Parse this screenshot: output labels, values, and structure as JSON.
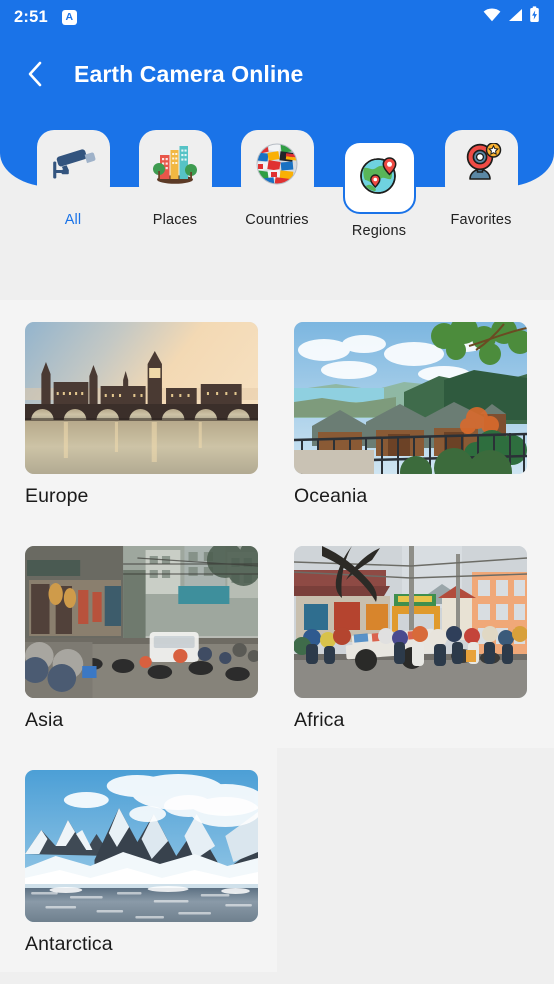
{
  "status_bar": {
    "time": "2:51",
    "notification_badge": "A",
    "icons": [
      "wifi-icon",
      "cell-signal-icon",
      "battery-charging-icon"
    ]
  },
  "app_bar": {
    "back_icon": "chevron-left-icon",
    "title": "Earth Camera Online"
  },
  "tabs": [
    {
      "label": "All",
      "icon": "cctv-camera-icon",
      "selected": false,
      "label_active": true
    },
    {
      "label": "Places",
      "icon": "cityscape-icon",
      "selected": false,
      "label_active": false
    },
    {
      "label": "Countries",
      "icon": "flags-globe-icon",
      "selected": false,
      "label_active": false
    },
    {
      "label": "Regions",
      "icon": "globe-pin-icon",
      "selected": true,
      "label_active": false
    },
    {
      "label": "Favorites",
      "icon": "webcam-star-icon",
      "selected": false,
      "label_active": false
    }
  ],
  "regions": [
    {
      "label": "Europe",
      "image": "london-parliament-sunset"
    },
    {
      "label": "Oceania",
      "image": "queenstown-chalets-hillside"
    },
    {
      "label": "Asia",
      "image": "hanoi-street-motorbikes"
    },
    {
      "label": "Africa",
      "image": "african-market-street"
    },
    {
      "label": "Antarctica",
      "image": "antarctic-snow-peaks-sea"
    }
  ],
  "colors": {
    "brand_blue": "#1a73e8",
    "page_background": "#efefef",
    "card_background": "#f4f4f4",
    "text_primary": "#1b1b1b"
  }
}
